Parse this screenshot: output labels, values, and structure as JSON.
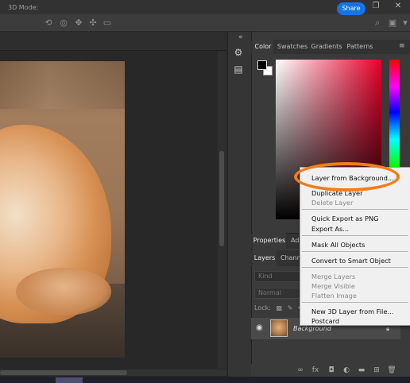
{
  "toolbar": {
    "mode_label": "3D Mode:",
    "share_label": "Share"
  },
  "color_panel": {
    "tabs": [
      "Color",
      "Swatches",
      "Gradients",
      "Patterns"
    ],
    "foreground_color": "#000000",
    "background_color": "#ffffff"
  },
  "props_panel": {
    "tabs": [
      "Properties",
      "Ad"
    ]
  },
  "layers_panel": {
    "tabs": [
      "Layers",
      "Chann"
    ],
    "filter_label": "Kind",
    "blend_mode": "Normal",
    "lock_label": "Lock:",
    "layer_name": "Background"
  },
  "context_menu": {
    "items": [
      {
        "label": "Layer from Background...",
        "enabled": true
      },
      {
        "label": "Duplicate Layer",
        "enabled": true
      },
      {
        "label": "Delete Layer",
        "enabled": false
      },
      {
        "label": "Quick Export as PNG",
        "enabled": true
      },
      {
        "label": "Export As...",
        "enabled": true
      },
      {
        "label": "Mask All Objects",
        "enabled": true
      },
      {
        "label": "Convert to Smart Object",
        "enabled": true
      },
      {
        "label": "Merge Layers",
        "enabled": false
      },
      {
        "label": "Merge Visible",
        "enabled": false
      },
      {
        "label": "Flatten Image",
        "enabled": false
      },
      {
        "label": "New 3D Layer from File...",
        "enabled": true
      },
      {
        "label": "Postcard",
        "enabled": true
      }
    ]
  },
  "colors": {
    "accent": "#1473e6",
    "highlight": "#f07d1c"
  }
}
